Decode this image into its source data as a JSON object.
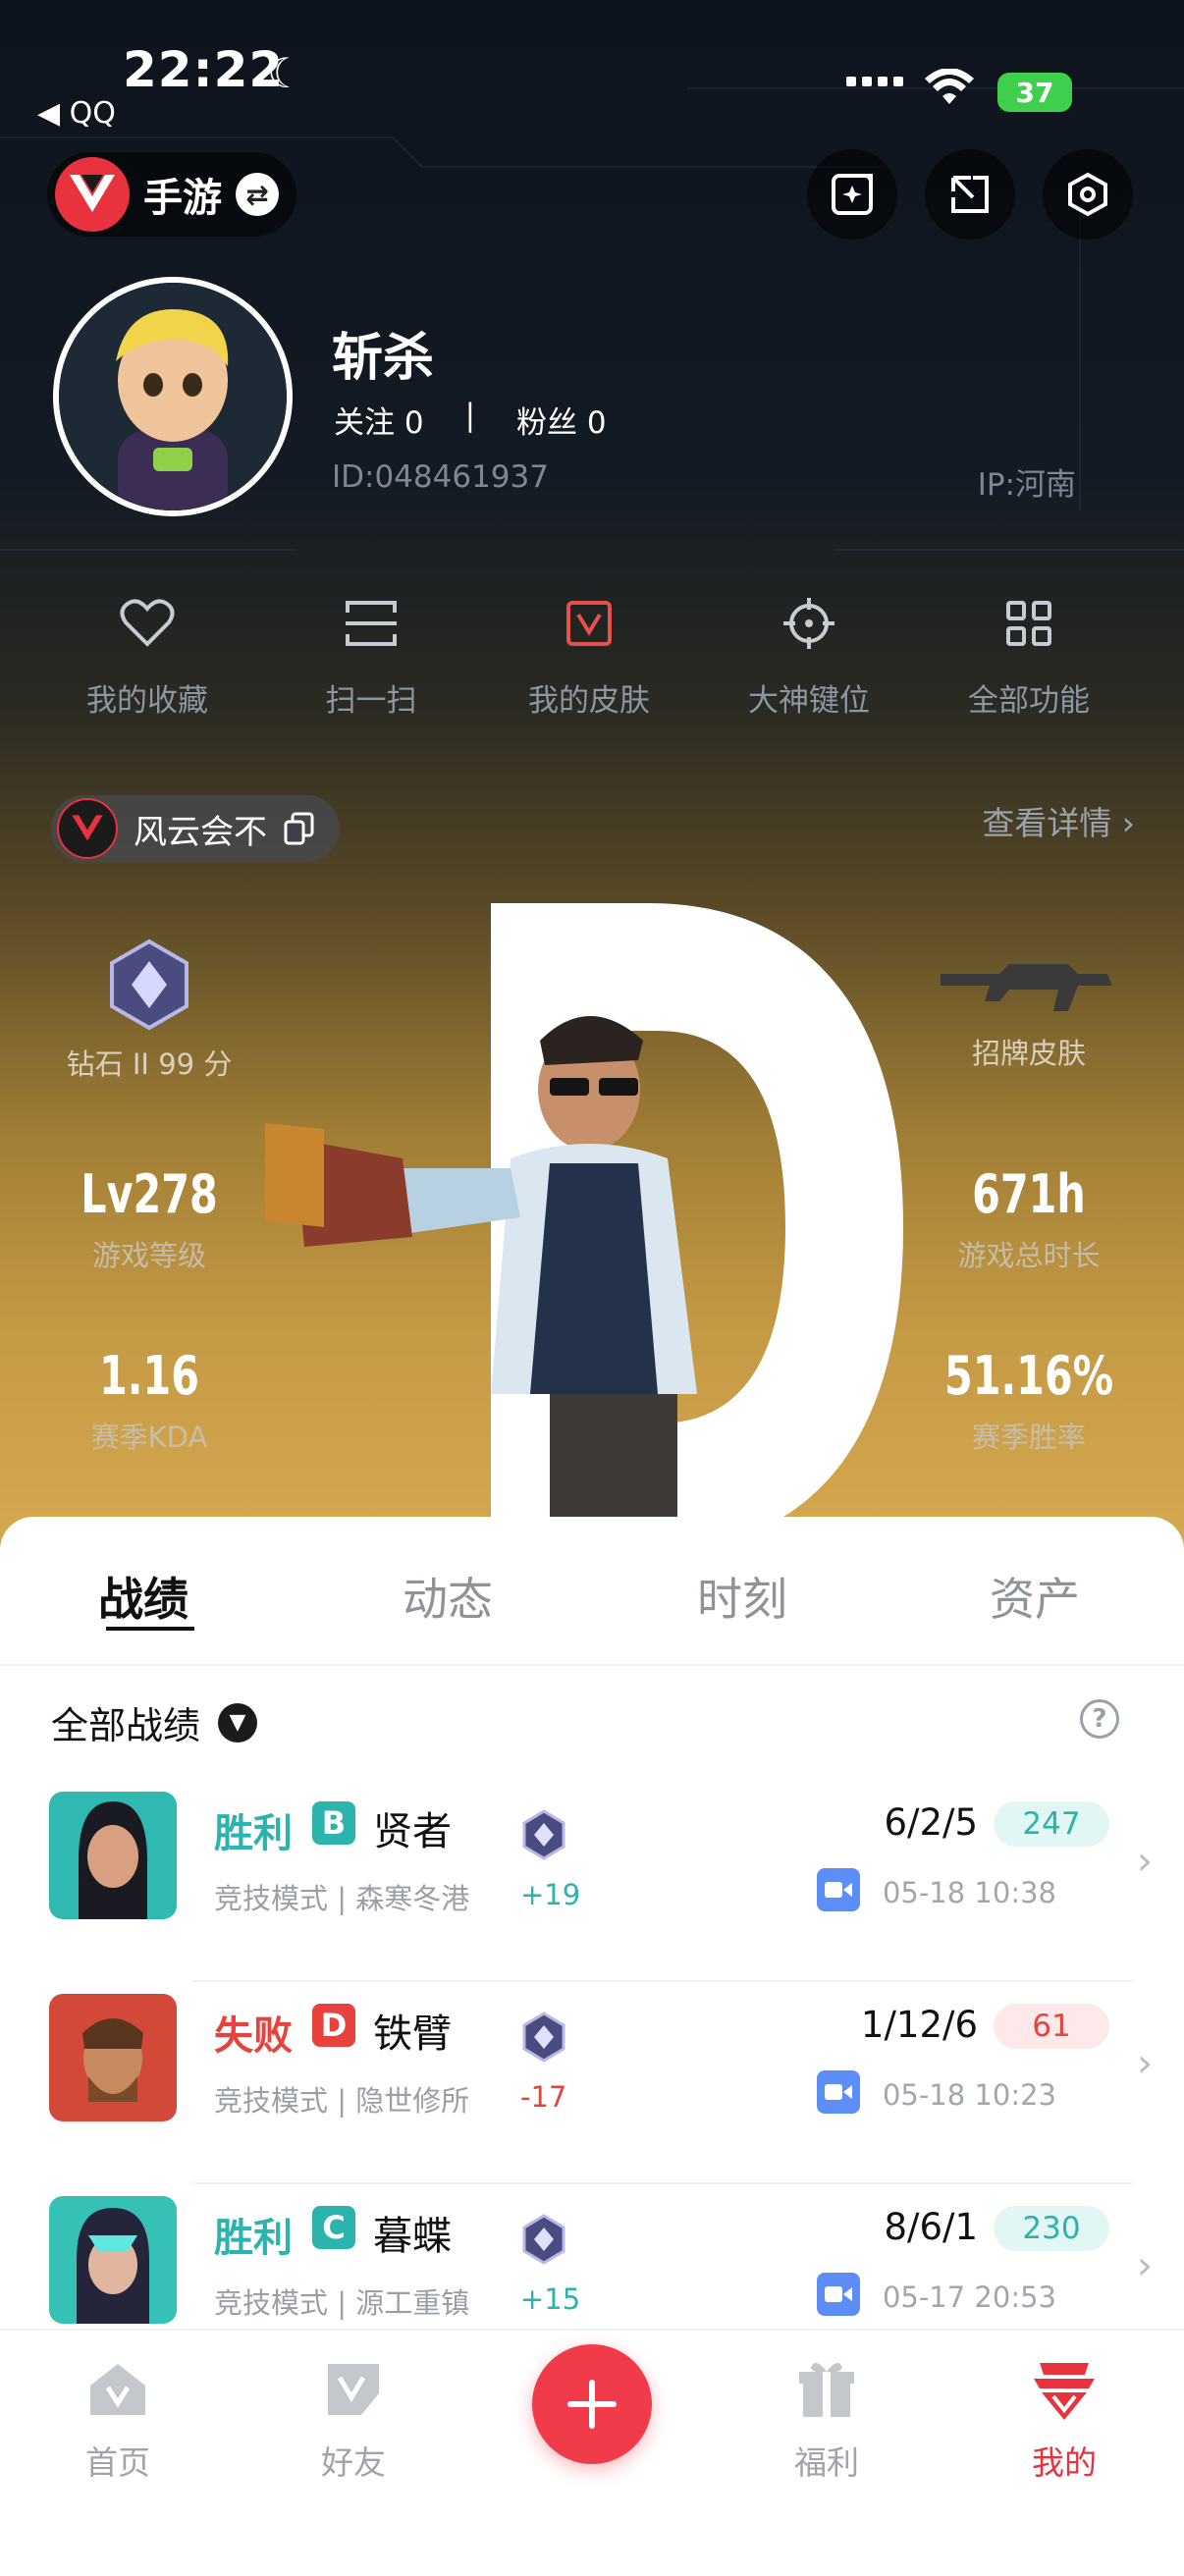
{
  "status_bar": {
    "time": "22:22",
    "back_app": "◀ QQ",
    "battery": "37"
  },
  "header": {
    "game_label": "手游"
  },
  "profile": {
    "name": "斩杀",
    "follow_label": "关注 0",
    "separator": "|",
    "fans_label": "粉丝 0",
    "id": "ID:048461937",
    "ip": "IP:河南"
  },
  "quick_actions": [
    {
      "label": "我的收藏",
      "icon": "heart-icon"
    },
    {
      "label": "扫一扫",
      "icon": "scan-icon"
    },
    {
      "label": "我的皮肤",
      "icon": "skin-icon"
    },
    {
      "label": "大神键位",
      "icon": "crosshair-icon"
    },
    {
      "label": "全部功能",
      "icon": "grid-icon"
    }
  ],
  "account": {
    "name": "风云会不",
    "view_detail": "查看详情 ›"
  },
  "stats": {
    "rank_label": "钻石 II 99 分",
    "skin_label": "招牌皮肤",
    "level_value": "Lv278",
    "level_label": "游戏等级",
    "hours_value": "671h",
    "hours_label": "游戏总时长",
    "kda_value": "1.16",
    "kda_label": "赛季KDA",
    "winrate_value": "51.16%",
    "winrate_label": "赛季胜率"
  },
  "tabs": [
    "战绩",
    "动态",
    "时刻",
    "资产"
  ],
  "filter": {
    "label": "全部战绩",
    "help": "?"
  },
  "matches": [
    {
      "result": "胜利",
      "result_color": "#2bb3ae",
      "rank": "B",
      "rank_color": "#2bb3ae",
      "hero": "贤者",
      "mode": "竞技模式 | 森寒冬港",
      "delta": "+19",
      "delta_color": "#2bb3ae",
      "kda": "6/2/5",
      "score": "247",
      "score_color": "#2bb3ae",
      "score_bg": "#e2f6f4",
      "date": "05-18 10:38"
    },
    {
      "result": "失败",
      "result_color": "#e8423e",
      "rank": "D",
      "rank_color": "#e8423e",
      "hero": "铁臂",
      "mode": "竞技模式 | 隐世修所",
      "delta": "-17",
      "delta_color": "#e8423e",
      "kda": "1/12/6",
      "score": "61",
      "score_color": "#e8423e",
      "score_bg": "#fde9ea",
      "date": "05-18 10:23"
    },
    {
      "result": "胜利",
      "result_color": "#2bb3ae",
      "rank": "C",
      "rank_color": "#2bb3ae",
      "hero": "暮蝶",
      "mode": "竞技模式 | 源工重镇",
      "delta": "+15",
      "delta_color": "#2bb3ae",
      "kda": "8/6/1",
      "score": "230",
      "score_color": "#2bb3ae",
      "score_bg": "#e2f6f4",
      "date": "05-17 20:53"
    }
  ],
  "nav": [
    {
      "label": "首页",
      "icon": "home-icon"
    },
    {
      "label": "好友",
      "icon": "friends-icon"
    },
    {
      "label": "",
      "icon": "plus-icon"
    },
    {
      "label": "福利",
      "icon": "gift-icon"
    },
    {
      "label": "我的",
      "icon": "profile-icon"
    }
  ]
}
